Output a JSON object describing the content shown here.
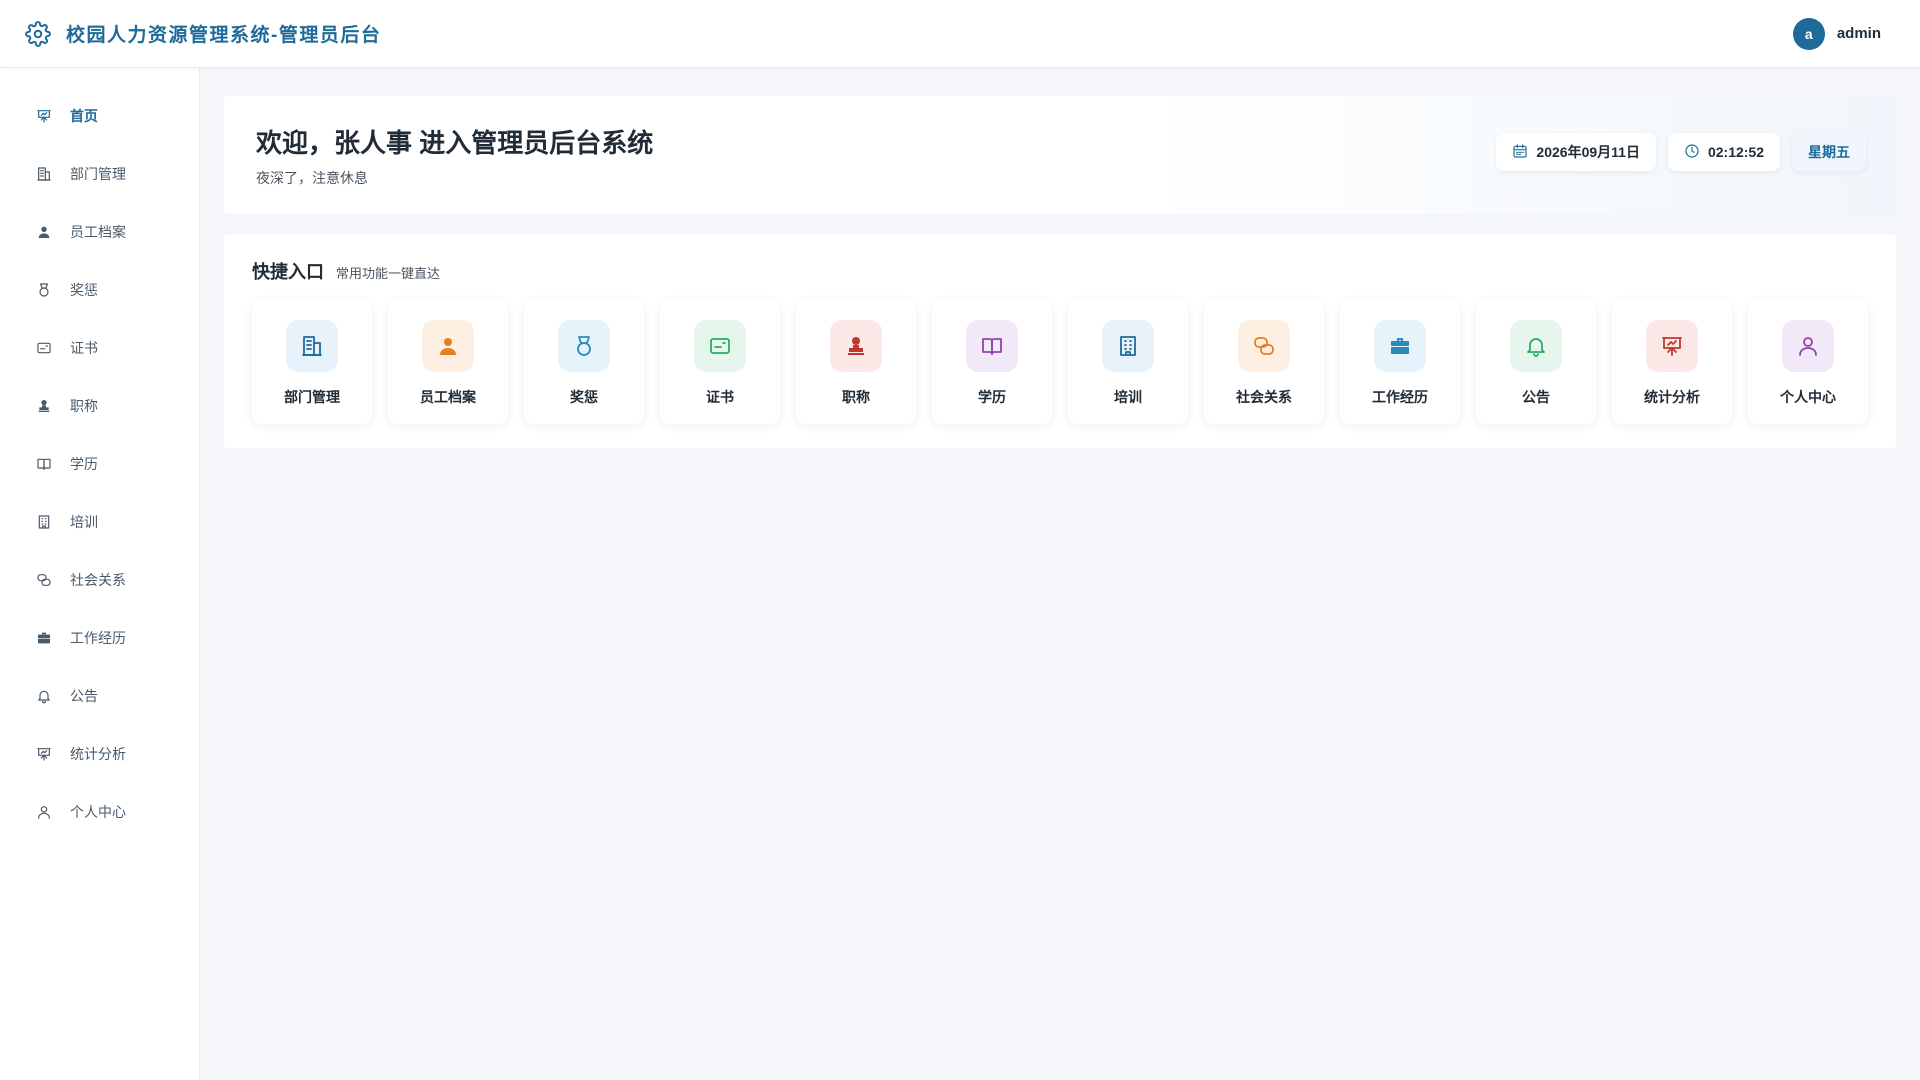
{
  "header": {
    "title": "校园人力资源管理系统-管理员后台",
    "brand_icon": "gear-icon",
    "user": {
      "avatar_letter": "a",
      "name": "admin"
    }
  },
  "sidebar": {
    "items": [
      {
        "label": "首页",
        "icon": "presentation-chart-icon",
        "active": true
      },
      {
        "label": "部门管理",
        "icon": "building-icon"
      },
      {
        "label": "员工档案",
        "icon": "user-icon"
      },
      {
        "label": "奖惩",
        "icon": "medal-icon"
      },
      {
        "label": "证书",
        "icon": "certificate-icon"
      },
      {
        "label": "职称",
        "icon": "stamp-icon"
      },
      {
        "label": "学历",
        "icon": "book-icon"
      },
      {
        "label": "培训",
        "icon": "office-building-icon"
      },
      {
        "label": "社会关系",
        "icon": "chat-bubbles-icon"
      },
      {
        "label": "工作经历",
        "icon": "briefcase-icon"
      },
      {
        "label": "公告",
        "icon": "bell-icon"
      },
      {
        "label": "统计分析",
        "icon": "presentation-chart-icon"
      },
      {
        "label": "个人中心",
        "icon": "user-outline-icon"
      }
    ]
  },
  "welcome": {
    "title": "欢迎，张人事 进入管理员后台系统",
    "subtitle": "夜深了，注意休息",
    "date": "2026年09月11日",
    "time": "02:12:52",
    "weekday": "星期五"
  },
  "quick": {
    "title": "快捷入口",
    "subtitle": "常用功能一键直达",
    "cards": [
      {
        "label": "部门管理",
        "icon": "building-icon",
        "bg": "#e8f2fb",
        "color": "#1e6a9a"
      },
      {
        "label": "员工档案",
        "icon": "user-icon",
        "bg": "#fdf0e3",
        "color": "#e67e22"
      },
      {
        "label": "奖惩",
        "icon": "medal-icon",
        "bg": "#e6f3fa",
        "color": "#2a8ab8"
      },
      {
        "label": "证书",
        "icon": "certificate-icon",
        "bg": "#e6f6ec",
        "color": "#27ae60"
      },
      {
        "label": "职称",
        "icon": "stamp-icon",
        "bg": "#fde8e8",
        "color": "#c0392b"
      },
      {
        "label": "学历",
        "icon": "book-icon",
        "bg": "#f1e9f7",
        "color": "#8e44ad"
      },
      {
        "label": "培训",
        "icon": "office-building-icon",
        "bg": "#e8f2fb",
        "color": "#1e6a9a"
      },
      {
        "label": "社会关系",
        "icon": "chat-bubbles-icon",
        "bg": "#fdf0e3",
        "color": "#e67e22"
      },
      {
        "label": "工作经历",
        "icon": "briefcase-icon",
        "bg": "#e6f3fa",
        "color": "#2a8ab8"
      },
      {
        "label": "公告",
        "icon": "bell-icon",
        "bg": "#e6f6ec",
        "color": "#27ae60"
      },
      {
        "label": "统计分析",
        "icon": "presentation-chart-icon",
        "bg": "#fde8e8",
        "color": "#c0392b"
      },
      {
        "label": "个人中心",
        "icon": "user-outline-icon",
        "bg": "#f1e9f7",
        "color": "#8e44ad"
      }
    ]
  }
}
